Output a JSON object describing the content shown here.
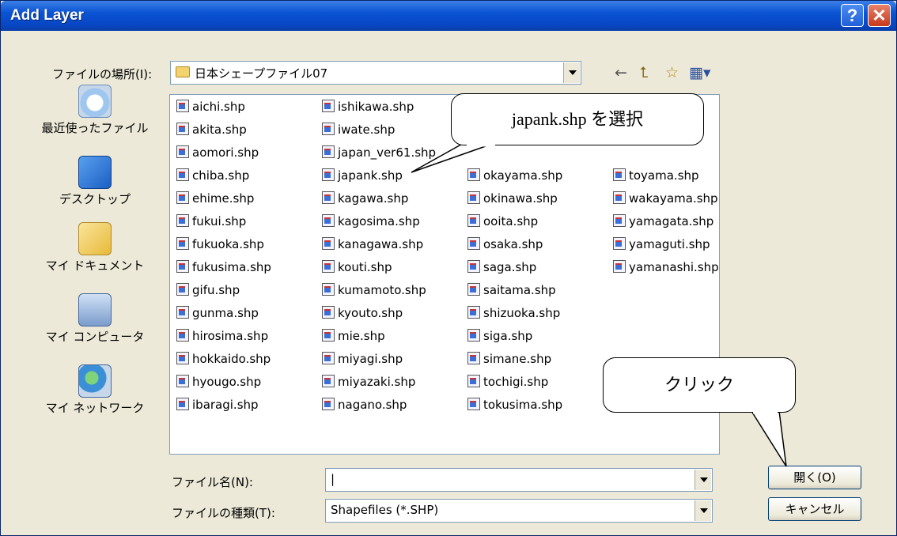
{
  "window": {
    "title": "Add Layer",
    "help": "?",
    "close": "✕"
  },
  "lookin": {
    "label": "ファイルの場所(I):",
    "value": "日本シェープファイル07"
  },
  "toolbar": {
    "back": "←",
    "up": "⮤",
    "newfolder": "☆",
    "views": "▦▾"
  },
  "places": [
    {
      "label": "最近使ったファイル",
      "icon": "recent-icon"
    },
    {
      "label": "デスクトップ",
      "icon": "desktop-icon"
    },
    {
      "label": "マイ ドキュメント",
      "icon": "my-documents-icon"
    },
    {
      "label": "マイ コンピュータ",
      "icon": "my-computer-icon"
    },
    {
      "label": "マイ ネットワーク",
      "icon": "my-network-icon"
    }
  ],
  "files": {
    "col1": [
      "aichi.shp",
      "akita.shp",
      "aomori.shp",
      "chiba.shp",
      "ehime.shp",
      "fukui.shp",
      "fukuoka.shp",
      "fukusima.shp",
      "gifu.shp",
      "gunma.shp",
      "hirosima.shp",
      "hokkaido.shp",
      "hyougo.shp",
      "ibaragi.shp"
    ],
    "col2": [
      "ishikawa.shp",
      "iwate.shp",
      "japan_ver61.shp",
      "japank.shp",
      "kagawa.shp",
      "kagosima.shp",
      "kanagawa.shp",
      "kouti.shp",
      "kumamoto.shp",
      "kyouto.shp",
      "mie.shp",
      "miyagi.shp",
      "miyazaki.shp",
      "nagano.shp"
    ],
    "col3": [
      "",
      "",
      "",
      "okayama.shp",
      "okinawa.shp",
      "ooita.shp",
      "osaka.shp",
      "saga.shp",
      "saitama.shp",
      "shizuoka.shp",
      "siga.shp",
      "simane.shp",
      "tochigi.shp",
      "tokusima.shp"
    ],
    "col4": [
      "",
      "",
      "",
      "toyama.shp",
      "wakayama.shp",
      "yamagata.shp",
      "yamaguti.shp",
      "yamanashi.shp"
    ]
  },
  "filename": {
    "label": "ファイル名(N):",
    "value": "|"
  },
  "filetype": {
    "label": "ファイルの種類(T):",
    "value": "Shapefiles (*.SHP)"
  },
  "buttons": {
    "open": "開く(O)",
    "cancel": "キャンセル"
  },
  "callouts": {
    "select": "japank.shp を選択",
    "click": "クリック"
  }
}
